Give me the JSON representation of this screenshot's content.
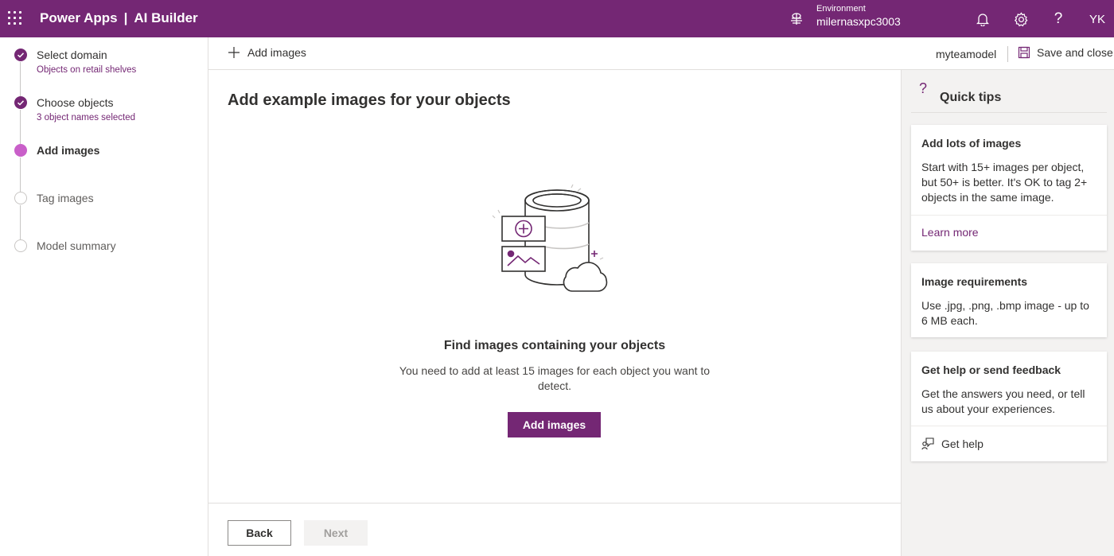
{
  "header": {
    "app_name": "Power Apps",
    "separator": "|",
    "product_name": "AI Builder",
    "environment_label": "Environment",
    "environment_name": "milernasxpc3003",
    "avatar_initials": "YK",
    "icons": [
      "waffle-icon",
      "environment-icon",
      "bell-icon",
      "gear-icon",
      "help-icon"
    ]
  },
  "stepper": {
    "steps": [
      {
        "label": "Select domain",
        "sub": "Objects on retail shelves",
        "state": "done"
      },
      {
        "label": "Choose objects",
        "sub": "3 object names selected",
        "state": "done"
      },
      {
        "label": "Add images",
        "sub": "",
        "state": "current"
      },
      {
        "label": "Tag images",
        "sub": "",
        "state": "todo"
      },
      {
        "label": "Model summary",
        "sub": "",
        "state": "todo"
      }
    ]
  },
  "commandbar": {
    "add_images_label": "Add images",
    "model_name": "myteamodel",
    "save_close_label": "Save and close"
  },
  "main": {
    "title": "Add example images for your objects",
    "empty_title": "Find images containing your objects",
    "empty_desc": "You need to add at least 15 images for each object you want to detect.",
    "add_button_label": "Add images",
    "back_label": "Back",
    "next_label": "Next"
  },
  "tips": {
    "header_icon": "?",
    "title": "Quick tips",
    "cards": [
      {
        "title": "Add lots of images",
        "text": "Start with 15+ images per object, but 50+ is better. It's OK to tag 2+ objects in the same image.",
        "link": "Learn more"
      },
      {
        "title": "Image requirements",
        "text": "Use .jpg, .png, .bmp image - up to 6 MB each."
      },
      {
        "title": "Get help or send feedback",
        "text": "Get the answers you need, or tell us about your experiences.",
        "link": "Get help"
      }
    ]
  },
  "colors": {
    "brand": "#742774",
    "current_step": "#c95fc9",
    "panel_bg": "#f3f2f1"
  }
}
